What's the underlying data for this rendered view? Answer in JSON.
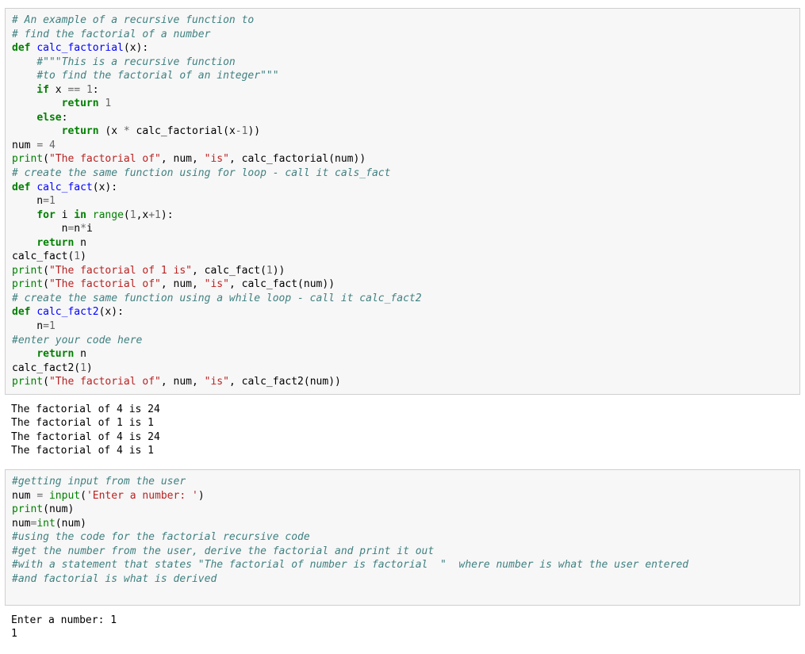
{
  "cell1": {
    "l01_cmt": "# An example of a recursive function to",
    "l02_cmt": "# find the factorial of a number",
    "l03_def": "def",
    "l03_name": "calc_factorial",
    "l03_rest": "(x):",
    "l04_cmt": "    #\"\"\"This is a recursive function",
    "l05_pre_cmt": "    ",
    "l05_cmt": "#to find the factorial of an integer\"\"\"",
    "l06_if": "    if",
    "l06_expr": " x ",
    "l06_op": "==",
    "l06_sp": " ",
    "l06_num": "1",
    "l06_colon": ":",
    "l07_pre": "        ",
    "l07_ret": "return",
    "l07_sp": " ",
    "l07_num": "1",
    "l08_pre_else": "    ",
    "l08_else": "else",
    "l08_colon": ":",
    "l09_pre": "        ",
    "l09_ret": "return",
    "l09_rest1": " (x ",
    "l09_op": "*",
    "l09_rest2": " calc_factorial(x",
    "l09_minus": "-",
    "l09_num": "1",
    "l09_close": "))",
    "l10_num": "num ",
    "l10_eq": "=",
    "l10_sp": " ",
    "l10_val": "4",
    "l11_print": "print",
    "l11_p1": "(",
    "l11_s1": "\"The factorial of\"",
    "l11_c1": ", num, ",
    "l11_s2": "\"is\"",
    "l11_c2": ", calc_factorial(num))",
    "l12_cmt": "# create the same function using for loop - call it cals_fact",
    "l13_def": "def",
    "l13_name": "calc_fact",
    "l13_rest": "(x):",
    "l14_pre": "    n",
    "l14_eq": "=",
    "l14_num": "1",
    "l15_pre": "    ",
    "l15_for": "for",
    "l15_i": " i ",
    "l15_in": "in",
    "l15_sp": " ",
    "l15_range": "range",
    "l15_p1": "(",
    "l15_n1": "1",
    "l15_comma": ",x",
    "l15_plus": "+",
    "l15_n2": "1",
    "l15_p2": "):",
    "l16_pre": "        n",
    "l16_eq": "=",
    "l16_rest": "n",
    "l16_op": "*",
    "l16_i": "i",
    "l17_pre": "    ",
    "l17_ret": "return",
    "l17_n": " n",
    "l18": "calc_fact(",
    "l18_num": "1",
    "l18_close": ")",
    "l19_print": "print",
    "l19_p1": "(",
    "l19_s1": "\"The factorial of 1 is\"",
    "l19_rest": ", calc_fact(",
    "l19_num": "1",
    "l19_close": "))",
    "l20_print": "print",
    "l20_p1": "(",
    "l20_s1": "\"The factorial of\"",
    "l20_c1": ", num, ",
    "l20_s2": "\"is\"",
    "l20_c2": ", calc_fact(num))",
    "l21_cmt": "# create the same function using a while loop - call it calc_fact2",
    "l22_def": "def",
    "l22_name": "calc_fact2",
    "l22_rest": "(x):",
    "l23_pre": "    n",
    "l23_eq": "=",
    "l23_num": "1",
    "l24_cmt": "#enter your code here",
    "l25_pre": "    ",
    "l25_ret": "return",
    "l25_n": " n",
    "l26": "calc_fact2(",
    "l26_num": "1",
    "l26_close": ")",
    "l27_print": "print",
    "l27_p1": "(",
    "l27_s1": "\"The factorial of\"",
    "l27_c1": ", num, ",
    "l27_s2": "\"is\"",
    "l27_c2": ", calc_fact2(num))"
  },
  "out1": {
    "l1": "The factorial of 4 is 24",
    "l2": "The factorial of 1 is 1",
    "l3": "The factorial of 4 is 24",
    "l4": "The factorial of 4 is 1"
  },
  "cell2": {
    "l1_cmt": "#getting input from the user",
    "l2_num": "num ",
    "l2_eq": "=",
    "l2_sp": " ",
    "l2_input": "input",
    "l2_p1": "(",
    "l2_s": "'Enter a number: '",
    "l2_p2": ")",
    "l3_print": "print",
    "l3_rest": "(num)",
    "l4_num": "num",
    "l4_eq": "=",
    "l4_int": "int",
    "l4_rest": "(num)",
    "l5_cmt": "#using the code for the factorial recursive code",
    "l6_cmt": "#get the number from the user, derive the factorial and print it out",
    "l7_cmt": "#with a statement that states \"The factorial of number is factorial  \"  where number is what the user entered",
    "l8_cmt": "#and factorial is what is derived"
  },
  "out2": {
    "l1": "Enter a number: 1",
    "l2": "1"
  }
}
